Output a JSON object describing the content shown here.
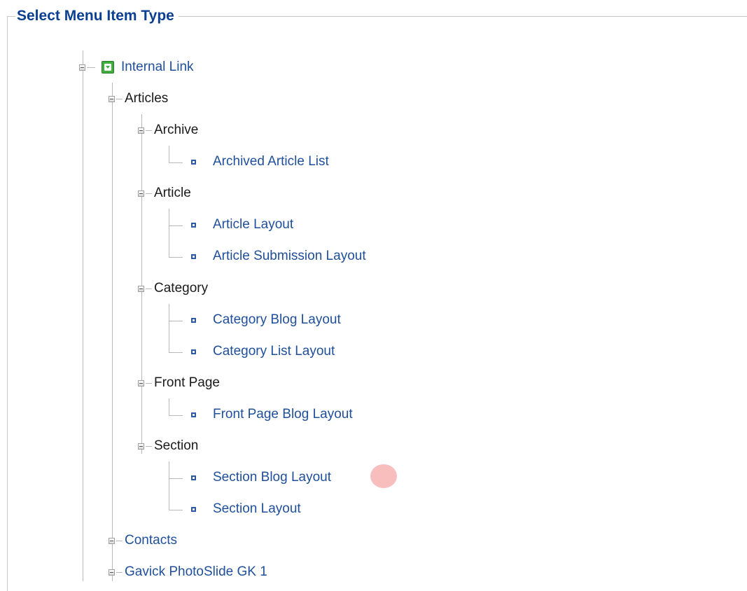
{
  "legend": "Select Menu Item Type",
  "tree": {
    "root": "Internal Link",
    "articles": "Articles",
    "archive": "Archive",
    "archived_article_list": "Archived Article List",
    "article": "Article",
    "article_layout": "Article Layout",
    "article_submission_layout": "Article Submission Layout",
    "category": "Category",
    "category_blog_layout": "Category Blog Layout",
    "category_list_layout": "Category List Layout",
    "front_page": "Front Page",
    "front_page_blog_layout": "Front Page Blog Layout",
    "section": "Section",
    "section_blog_layout": "Section Blog Layout",
    "section_layout": "Section Layout",
    "contacts": "Contacts",
    "gavick": "Gavick PhotoSlide GK 1"
  },
  "colors": {
    "legend": "#0b3f91",
    "link": "#1f4f9a",
    "category_text": "#1a1a1a",
    "tree_line": "#b9b9b9",
    "cursor_highlight": "#f7b3b3"
  },
  "icons": {
    "expander": "minus-square-icon",
    "leaf": "menu-item-square-icon",
    "root": "green-dropdown-icon"
  }
}
